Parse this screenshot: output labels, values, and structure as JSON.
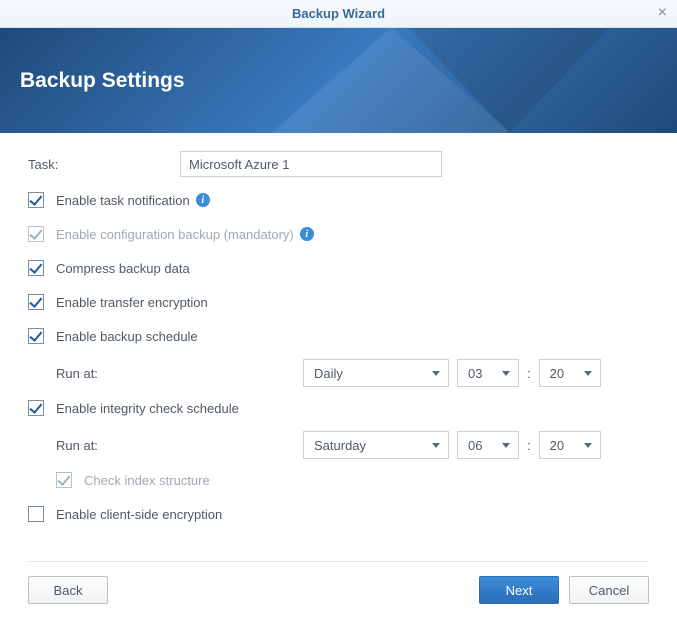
{
  "titlebar": {
    "title": "Backup Wizard"
  },
  "banner": {
    "title": "Backup Settings"
  },
  "form": {
    "task_label": "Task:",
    "task_value": "Microsoft Azure 1",
    "enable_notification": "Enable task notification",
    "enable_config_backup": "Enable configuration backup (mandatory)",
    "compress_data": "Compress backup data",
    "enable_encryption": "Enable transfer encryption",
    "enable_schedule": "Enable backup schedule",
    "run_at": "Run at:",
    "schedule_freq": "Daily",
    "schedule_hour": "03",
    "schedule_min": "20",
    "enable_integrity": "Enable integrity check schedule",
    "integrity_freq": "Saturday",
    "integrity_hour": "06",
    "integrity_min": "20",
    "check_index": "Check index structure",
    "enable_client_encryption": "Enable client-side encryption"
  },
  "footer": {
    "back": "Back",
    "next": "Next",
    "cancel": "Cancel"
  }
}
